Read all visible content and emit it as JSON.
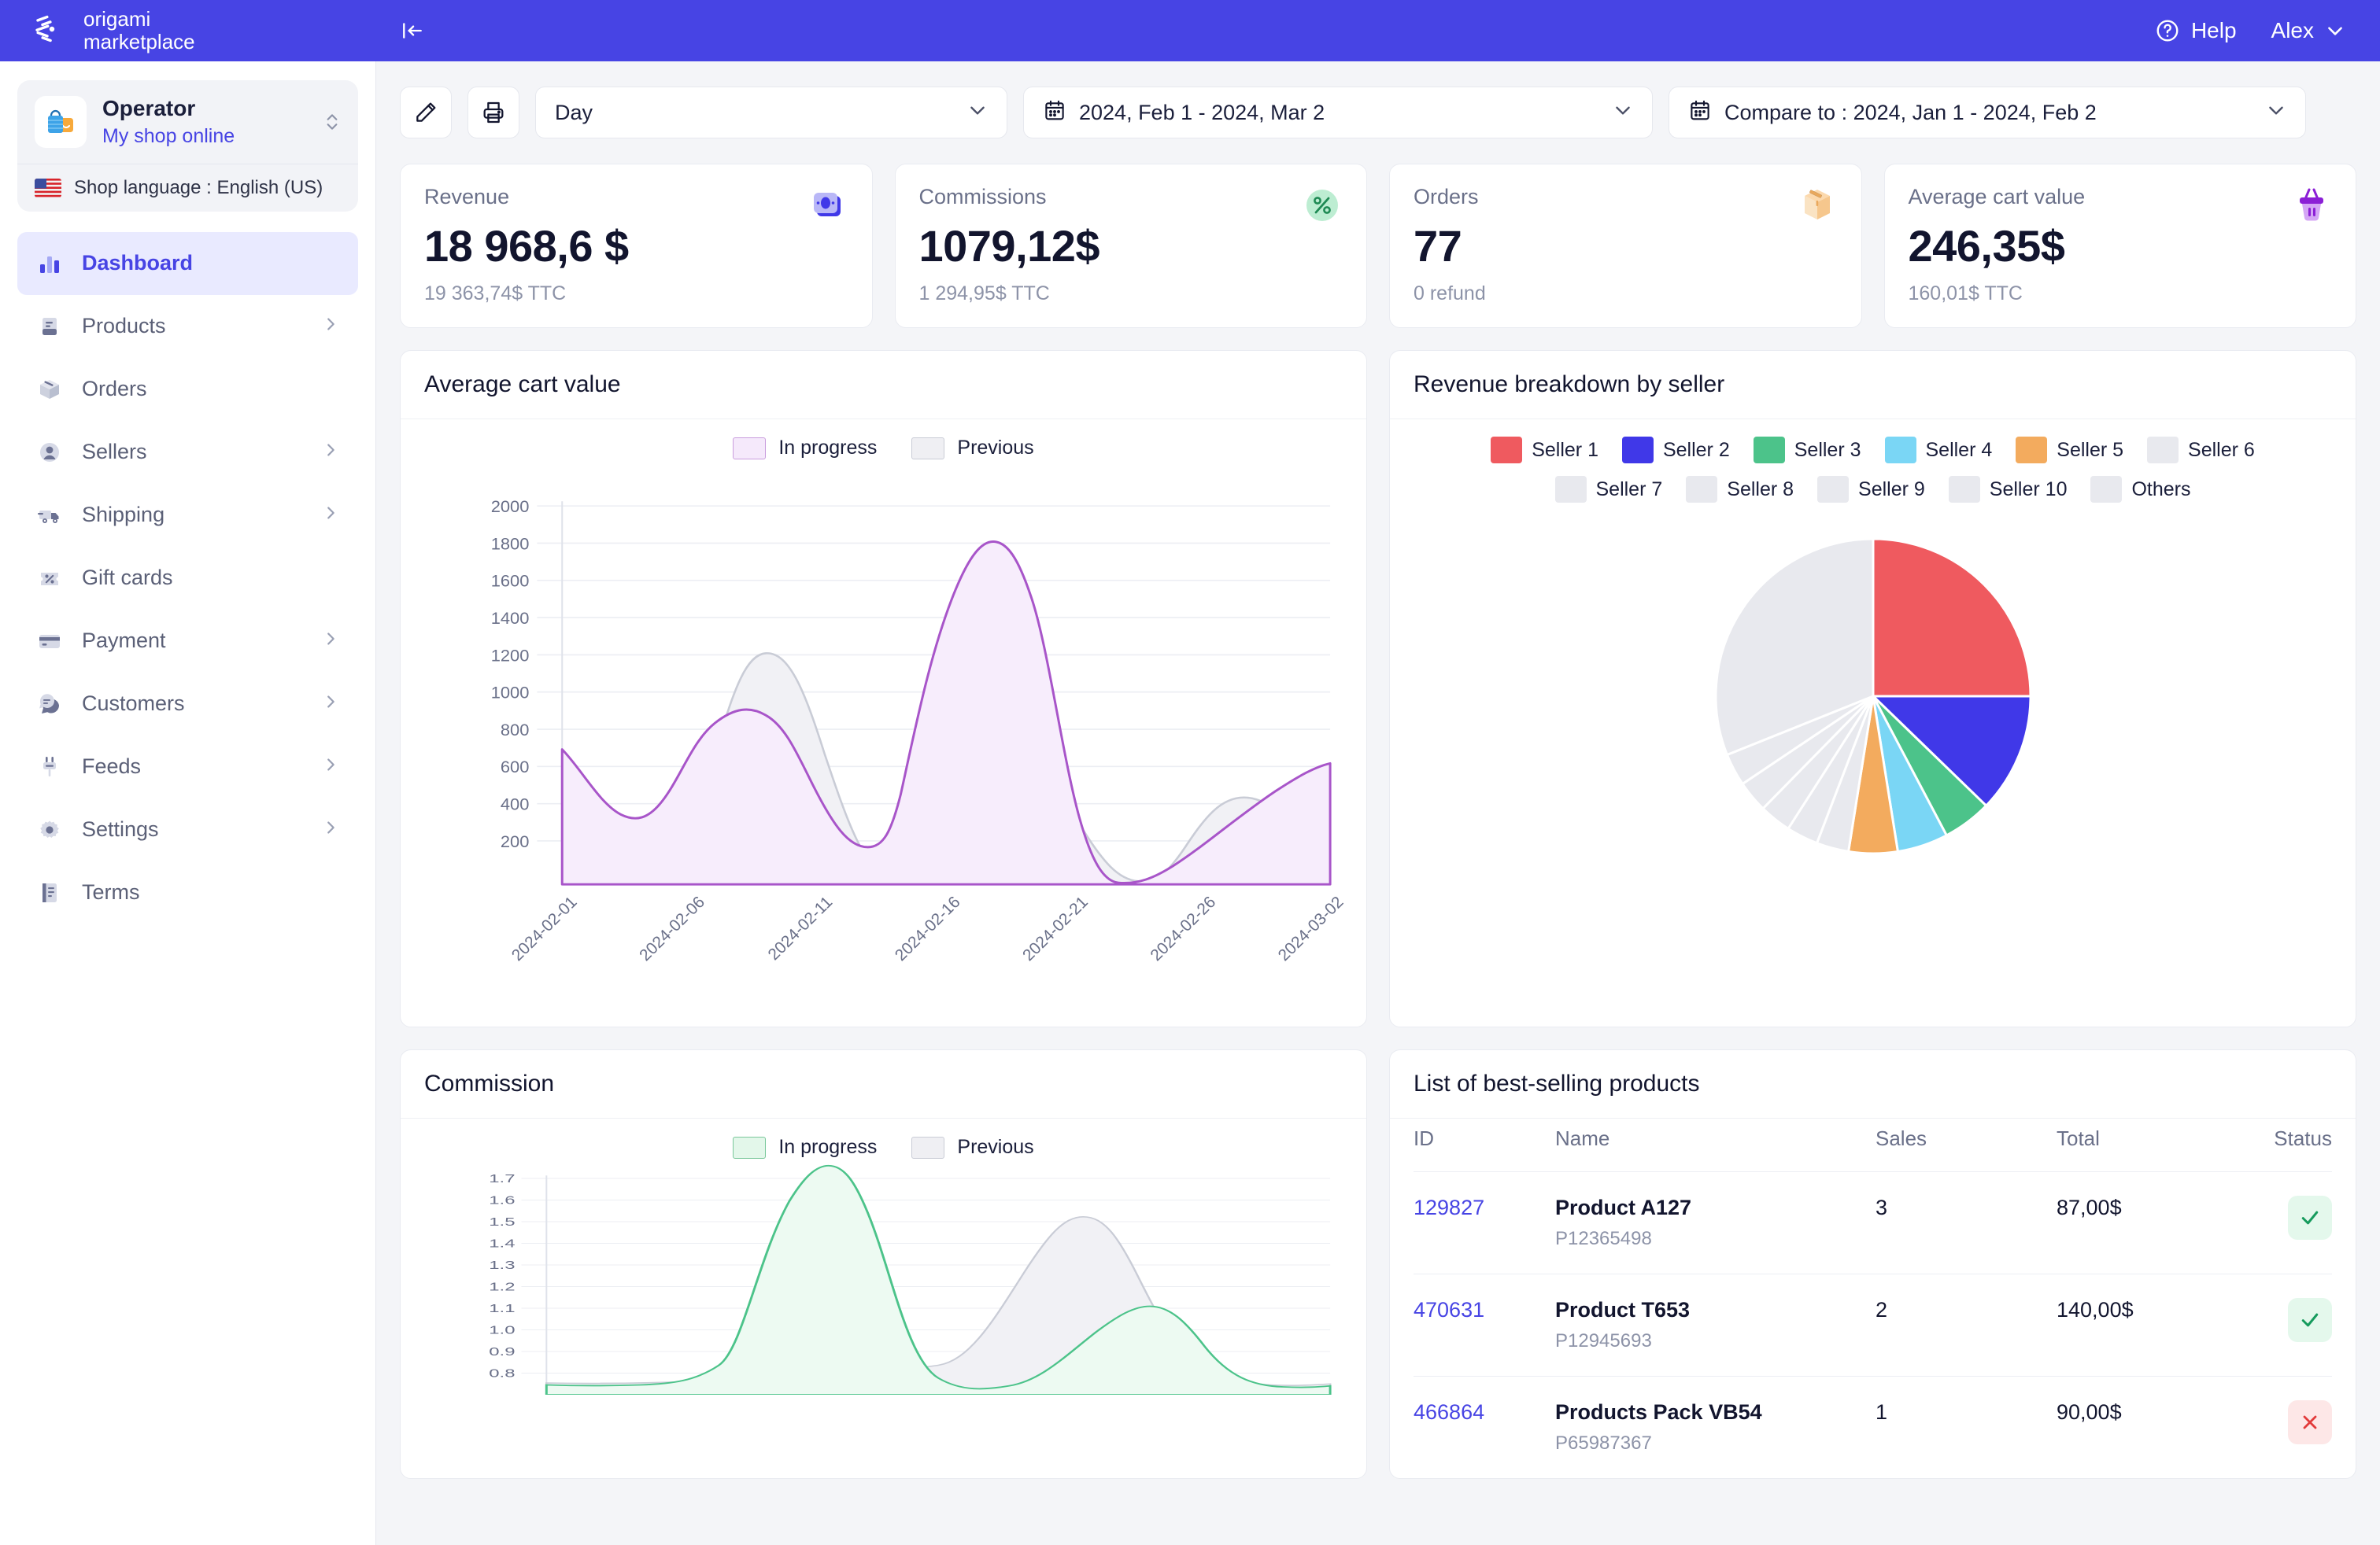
{
  "topbar": {
    "brand_line1": "origami",
    "brand_line2": "marketplace",
    "collapse_icon": "collapse-sidebar-icon",
    "help_label": "Help",
    "help_icon": "question-circle-icon",
    "user_label": "Alex",
    "user_caret": "chevron-down-icon",
    "accent": "#4744e4"
  },
  "sidebar": {
    "shop": {
      "name": "Operator",
      "subtitle": "My shop online",
      "avatar_icon": "shopping-bag-icon",
      "switch_icon": "chevron-up-down-icon",
      "language_label": "Shop language : English (US)",
      "flag_icon": "us-flag-icon"
    },
    "items": [
      {
        "label": "Dashboard",
        "icon": "bar-chart-icon",
        "active": true,
        "expandable": false
      },
      {
        "label": "Products",
        "icon": "book-icon",
        "active": false,
        "expandable": true
      },
      {
        "label": "Orders",
        "icon": "box-icon",
        "active": false,
        "expandable": false
      },
      {
        "label": "Sellers",
        "icon": "user-icon",
        "active": false,
        "expandable": true
      },
      {
        "label": "Shipping",
        "icon": "truck-icon",
        "active": false,
        "expandable": true
      },
      {
        "label": "Gift cards",
        "icon": "percent-tag-icon",
        "active": false,
        "expandable": false
      },
      {
        "label": "Payment",
        "icon": "credit-card-icon",
        "active": false,
        "expandable": true
      },
      {
        "label": "Customers",
        "icon": "chat-icon",
        "active": false,
        "expandable": true
      },
      {
        "label": "Feeds",
        "icon": "plug-icon",
        "active": false,
        "expandable": true
      },
      {
        "label": "Settings",
        "icon": "gear-icon",
        "active": false,
        "expandable": true
      },
      {
        "label": "Terms",
        "icon": "document-icon",
        "active": false,
        "expandable": false
      }
    ]
  },
  "toolbar": {
    "edit_icon": "pencil-icon",
    "print_icon": "printer-icon",
    "granularity": "Day",
    "granularity_caret": "chevron-down-icon",
    "date_range": "2024, Feb 1 - 2024, Mar 2",
    "date_range_icon": "calendar-icon",
    "compare_range": "Compare to : 2024, Jan 1 - 2024, Feb 2",
    "compare_icon": "calendar-icon"
  },
  "kpis": [
    {
      "title": "Revenue",
      "value": "18 968,6 $",
      "sub": "19 363,74$ TTC",
      "icon": "money-icon"
    },
    {
      "title": "Commissions",
      "value": "1079,12$",
      "sub": "1 294,95$ TTC",
      "icon": "percent-badge-icon"
    },
    {
      "title": "Orders",
      "value": "77",
      "sub": "0 refund",
      "icon": "package-icon"
    },
    {
      "title": "Average cart value",
      "value": "246,35$",
      "sub": "160,01$ TTC",
      "icon": "basket-icon"
    }
  ],
  "cart_panel": {
    "title": "Average cart value",
    "legend": [
      {
        "label": "In progress",
        "color": "#f5e9fb",
        "border": "#c99ddd"
      },
      {
        "label": "Previous",
        "color": "#efeff3",
        "border": "#c9ccd6"
      }
    ]
  },
  "seller_panel": {
    "title": "Revenue breakdown by seller"
  },
  "commission_panel": {
    "title": "Commission",
    "legend": [
      {
        "label": "In progress",
        "color": "#e3f7ea",
        "border": "#79c79a"
      },
      {
        "label": "Previous",
        "color": "#efeff3",
        "border": "#c9ccd6"
      }
    ]
  },
  "products_panel": {
    "title": "List of best-selling products",
    "columns": [
      "ID",
      "Name",
      "Sales",
      "Total",
      "Status"
    ],
    "rows": [
      {
        "id": "129827",
        "name": "Product A127",
        "ref": "P12365498",
        "sales": "3",
        "total": "87,00$",
        "status": "ok",
        "status_icon": "check-icon"
      },
      {
        "id": "470631",
        "name": "Product T653",
        "ref": "P12945693",
        "sales": "2",
        "total": "140,00$",
        "status": "ok",
        "status_icon": "check-icon"
      },
      {
        "id": "466864",
        "name": "Products Pack VB54",
        "ref": "P65987367",
        "sales": "1",
        "total": "90,00$",
        "status": "ko",
        "status_icon": "close-icon"
      }
    ]
  },
  "chart_data": [
    {
      "type": "area",
      "title": "Average cart value",
      "xlabel": "",
      "ylabel": "",
      "ylim": [
        0,
        2100
      ],
      "yticks": [
        200,
        400,
        600,
        800,
        1000,
        1200,
        1400,
        1600,
        1800,
        2000
      ],
      "grid": true,
      "legend_position": "top-center",
      "x": [
        "2024-02-01",
        "2024-02-06",
        "2024-02-11",
        "2024-02-16",
        "2024-02-21",
        "2024-02-26",
        "2024-03-02"
      ],
      "xtick_rotation": 45,
      "series": [
        {
          "name": "In progress",
          "color": "#a855c9",
          "fill": "#f5e9fb",
          "values": [
            830,
            560,
            530,
            700,
            1000,
            900,
            560,
            400,
            390,
            980,
            2000,
            1950,
            640,
            200,
            200,
            300,
            640
          ]
        },
        {
          "name": "Previous",
          "color": "#c9ccd6",
          "fill": "#f1f1f5",
          "values": [
            330,
            200,
            210,
            600,
            1400,
            1350,
            700,
            260,
            250,
            500,
            680,
            640,
            330,
            200,
            260,
            480,
            450
          ]
        }
      ]
    },
    {
      "type": "pie",
      "title": "Revenue breakdown by seller",
      "legend_position": "top",
      "labels": [
        "Seller 1",
        "Seller 2",
        "Seller 3",
        "Seller 4",
        "Seller 5",
        "Seller 6",
        "Seller 7",
        "Seller 8",
        "Seller 9",
        "Seller 10",
        "Others"
      ],
      "colors": [
        "#ef5a5f",
        "#4038e8",
        "#4cc38a",
        "#7ad6f5",
        "#f3ab5e",
        "#e8e9ee",
        "#e8e9ee",
        "#e8e9ee",
        "#e8e9ee",
        "#e8e9ee",
        "#e8e9ee"
      ],
      "values": [
        25.0,
        11.5,
        6.0,
        5.0,
        5.0,
        3.2,
        3.0,
        2.8,
        2.6,
        2.4,
        33.5
      ]
    },
    {
      "type": "area",
      "title": "Commission",
      "xlabel": "",
      "ylabel": "",
      "ylim": [
        0.75,
        1.75
      ],
      "yticks": [
        0.8,
        0.9,
        1.0,
        1.1,
        1.2,
        1.3,
        1.4,
        1.5,
        1.6,
        1.7
      ],
      "grid": true,
      "legend_position": "top-center",
      "series": [
        {
          "name": "In progress",
          "color": "#4cc38a",
          "fill": "#e9f8ef",
          "values": [
            0.78,
            0.78,
            0.79,
            1.1,
            1.7,
            1.32,
            0.82,
            0.78,
            0.8,
            0.92,
            0.86,
            0.79
          ]
        },
        {
          "name": "Previous",
          "color": "#c9ccd6",
          "fill": "#f1f1f5",
          "values": [
            0.77,
            0.77,
            0.78,
            0.8,
            0.82,
            0.82,
            0.8,
            0.84,
            1.25,
            1.45,
            1.05,
            0.8
          ]
        }
      ]
    }
  ]
}
